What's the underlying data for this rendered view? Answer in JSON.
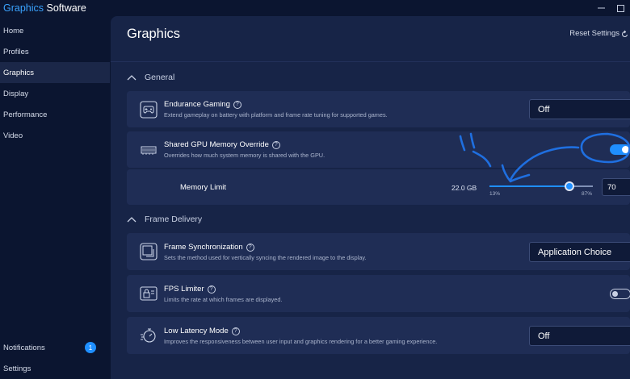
{
  "app": {
    "title_brand": "Graphics",
    "title_rest": " Software"
  },
  "sidebar": {
    "items": [
      {
        "label": "Home"
      },
      {
        "label": "Profiles"
      },
      {
        "label": "Graphics",
        "active": true
      },
      {
        "label": "Display"
      },
      {
        "label": "Performance"
      },
      {
        "label": "Video"
      }
    ],
    "bottom": [
      {
        "label": "Notifications",
        "badge": "1"
      },
      {
        "label": "Settings"
      }
    ]
  },
  "main": {
    "title": "Graphics",
    "reset_label": "Reset Settings"
  },
  "sections": {
    "general": {
      "label": "General",
      "endurance": {
        "label": "Endurance Gaming",
        "desc": "Extend gameplay on battery with platform and frame rate tuning for supported games.",
        "value": "Off",
        "icon": "gamepad-battery-icon"
      },
      "shared_gpu": {
        "label": "Shared GPU Memory Override",
        "desc": "Overrides how much system memory is shared with the GPU.",
        "state": "On",
        "enabled": true,
        "icon": "memory-chip-icon"
      },
      "memory_limit": {
        "label": "Memory Limit",
        "value_text": "22.0 GB",
        "min_label": "13%",
        "max_label": "87%",
        "min": 13,
        "max": 87,
        "value": 70,
        "value_display": "70"
      }
    },
    "frame_delivery": {
      "label": "Frame Delivery",
      "frame_sync": {
        "label": "Frame Synchronization",
        "desc": "Sets the method used for vertically syncing the rendered image to the display.",
        "value": "Application Choice",
        "icon": "frame-sync-icon"
      },
      "fps_limiter": {
        "label": "FPS Limiter",
        "desc": "Limits the rate at which frames are displayed.",
        "state": "Off",
        "enabled": false,
        "icon": "fps-lock-icon"
      },
      "low_latency": {
        "label": "Low Latency Mode",
        "desc": "Improves the responsiveness between user input and graphics rendering for a better gaming experience.",
        "value": "Off",
        "icon": "stopwatch-icon"
      }
    }
  },
  "colors": {
    "accent": "#1f8fff",
    "annotation": "#1f6fe0",
    "background": "#0b1530",
    "panel": "#172447",
    "card": "#1f2d55"
  }
}
